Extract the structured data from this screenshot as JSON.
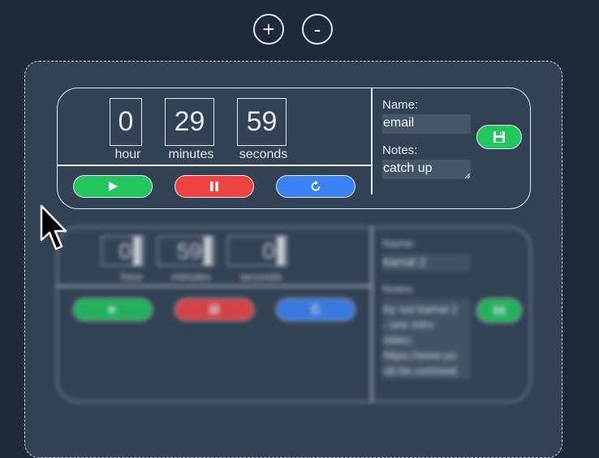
{
  "zoom_controls": {
    "plus_label": "+",
    "minus_label": "-"
  },
  "timers": [
    {
      "hour": "0",
      "minutes": "29",
      "seconds": "59",
      "hour_label": "hour",
      "minutes_label": "minutes",
      "seconds_label": "seconds",
      "name_label": "Name:",
      "name_value": "email",
      "notes_label": "Notes:",
      "notes_value": "catch up"
    },
    {
      "hour": "0",
      "minutes": "59",
      "seconds": "0",
      "hour_label": "hour",
      "minutes_label": "minutes",
      "seconds_label": "seconds",
      "name_label": "Name:",
      "name_value": "kamal 2",
      "notes_label": "Notes:",
      "notes_lines": [
        "try out kamal 2",
        "- see intro",
        "video:",
        "https://www.yo",
        "ub.be.com/wat"
      ]
    }
  ],
  "colors": {
    "background": "#1e293b",
    "panel": "#334155",
    "field": "#475569",
    "play": "#22c55e",
    "pause": "#ef4444",
    "reset": "#3b82f6",
    "save": "#22c55e"
  },
  "icons": {
    "play": "play-icon",
    "pause": "pause-icon",
    "reset": "refresh-icon",
    "save": "floppy-disk-icon",
    "cursor": "mouse-pointer-icon"
  }
}
